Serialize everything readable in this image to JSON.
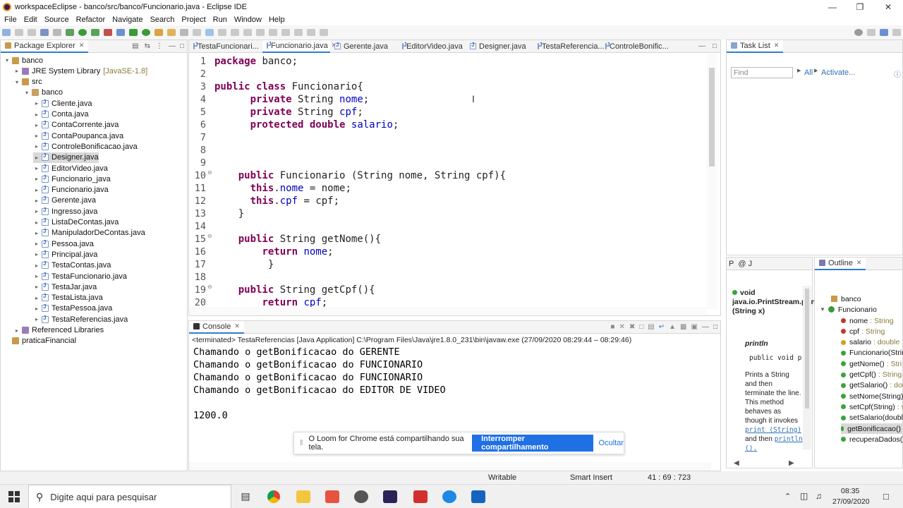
{
  "window": {
    "title": "workspaceEclipse - banco/src/banco/Funcionario.java - Eclipse IDE"
  },
  "menu": [
    "File",
    "Edit",
    "Source",
    "Refactor",
    "Navigate",
    "Search",
    "Project",
    "Run",
    "Window",
    "Help"
  ],
  "package_explorer": {
    "tab_label": "Package Explorer",
    "project": "banco",
    "jre": "JRE System Library",
    "jre_version": "[JavaSE-1.8]",
    "src": "src",
    "package": "banco",
    "files": [
      "Cliente.java",
      "Conta.java",
      "ContaCorrente.java",
      "ContaPoupanca.java",
      "ControleBonificacao.java",
      "Designer.java",
      "EditorVideo.java",
      "Funcionario_java",
      "Funcionario.java",
      "Gerente.java",
      "Ingresso.java",
      "ListaDeContas.java",
      "ManipuladorDeContas.java",
      "Pessoa.java",
      "Principal.java",
      "TestaContas.java",
      "TestaFuncionario.java",
      "TestaJar.java",
      "TestaLista.java",
      "TestaPessoa.java",
      "TestaReferencias.java"
    ],
    "selected_file": "Designer.java",
    "referenced_libraries": "Referenced Libraries",
    "other_project": "praticaFinancial"
  },
  "editor": {
    "tabs": [
      "TestaFuncionari...",
      "Funcionario.java",
      "Gerente.java",
      "EditorVideo.java",
      "Designer.java",
      "TestaReferencia...",
      "ControleBonific..."
    ],
    "active_tab": "Funcionario.java",
    "line_numbers": [
      "1",
      "2",
      "3",
      "4",
      "5",
      "6",
      "7",
      "8",
      "9",
      "10",
      "11",
      "12",
      "13",
      "14",
      "15",
      "16",
      "17",
      "18",
      "19",
      "20"
    ],
    "lines": [
      [
        [
          "kw",
          "package"
        ],
        [
          "t",
          " banco;"
        ]
      ],
      [],
      [
        [
          "kw",
          "public"
        ],
        [
          "t",
          " "
        ],
        [
          "kw",
          "class"
        ],
        [
          "t",
          " Funcionario{"
        ]
      ],
      [
        [
          "t",
          "      "
        ],
        [
          "kw",
          "private"
        ],
        [
          "t",
          " String "
        ],
        [
          "f",
          "nome"
        ],
        [
          "t",
          ";"
        ]
      ],
      [
        [
          "t",
          "      "
        ],
        [
          "kw",
          "private"
        ],
        [
          "t",
          " String "
        ],
        [
          "f",
          "cpf"
        ],
        [
          "t",
          ";"
        ]
      ],
      [
        [
          "t",
          "      "
        ],
        [
          "kw",
          "protected"
        ],
        [
          "t",
          " "
        ],
        [
          "kw",
          "double"
        ],
        [
          "t",
          " "
        ],
        [
          "f",
          "salario"
        ],
        [
          "t",
          ";"
        ]
      ],
      [],
      [],
      [],
      [
        [
          "t",
          "    "
        ],
        [
          "kw",
          "public"
        ],
        [
          "t",
          " Funcionario (String nome, String cpf){"
        ]
      ],
      [
        [
          "t",
          "      "
        ],
        [
          "kw",
          "this"
        ],
        [
          "t",
          "."
        ],
        [
          "f",
          "nome"
        ],
        [
          "t",
          " = nome;"
        ]
      ],
      [
        [
          "t",
          "      "
        ],
        [
          "kw",
          "this"
        ],
        [
          "t",
          "."
        ],
        [
          "f",
          "cpf"
        ],
        [
          "t",
          " = cpf;"
        ]
      ],
      [
        [
          "t",
          "    }"
        ]
      ],
      [],
      [
        [
          "t",
          "    "
        ],
        [
          "kw",
          "public"
        ],
        [
          "t",
          " String getNome(){"
        ]
      ],
      [
        [
          "t",
          "        "
        ],
        [
          "kw",
          "return"
        ],
        [
          "t",
          " "
        ],
        [
          "f",
          "nome"
        ],
        [
          "t",
          ";"
        ]
      ],
      [
        [
          "t",
          "         }"
        ]
      ],
      [],
      [
        [
          "t",
          "    "
        ],
        [
          "kw",
          "public"
        ],
        [
          "t",
          " String getCpf(){"
        ]
      ],
      [
        [
          "t",
          "        "
        ],
        [
          "kw",
          "return"
        ],
        [
          "t",
          " "
        ],
        [
          "f",
          "cpf"
        ],
        [
          "t",
          ";"
        ]
      ]
    ]
  },
  "tasklist": {
    "tab_label": "Task List",
    "find_placeholder": "Find",
    "all_label": "All",
    "activate_label": "Activate..."
  },
  "javadoc": {
    "signature": "void java.io.PrintStream.println (String x)",
    "name": "println",
    "code": "public void p",
    "desc_1": "Prints a String and then terminate the line. This method behaves as though it invokes",
    "link_1": "print (String)",
    "desc_2": "and then",
    "link_2": "println ()."
  },
  "outline": {
    "tab_label": "Outline",
    "package": "banco",
    "class": "Funcionario",
    "members": [
      {
        "name": "nome",
        "type": " : String"
      },
      {
        "name": "cpf",
        "type": " : String"
      },
      {
        "name": "salario",
        "type": " : double"
      },
      {
        "name": "Funcionario(Strin",
        "type": ""
      },
      {
        "name": "getNome()",
        "type": " : Stri"
      },
      {
        "name": "getCpf()",
        "type": " : String"
      },
      {
        "name": "getSalario()",
        "type": " : dou"
      },
      {
        "name": "setNome(String)",
        "type": ""
      },
      {
        "name": "setCpf(String)",
        "type": " : v"
      },
      {
        "name": "setSalario(doubl",
        "type": ""
      },
      {
        "name": "getBonificacao()",
        "type": ""
      },
      {
        "name": "recuperaDados()",
        "type": ""
      }
    ]
  },
  "console": {
    "tab_label": "Console",
    "header": "<terminated> TestaReferencias [Java Application] C:\\Program Files\\Java\\jre1.8.0_231\\bin\\javaw.exe  (27/09/2020 08:29:44 – 08:29:46)",
    "lines": [
      "Chamando o getBonificacao do GERENTE",
      "Chamando o getBonificacao do FUNCIONARIO",
      "Chamando o getBonificacao do FUNCIONARIO",
      "Chamando o getBonificacao do EDITOR DE VIDEO",
      "",
      "1200.0"
    ]
  },
  "loom": {
    "message": "O Loom for Chrome está compartilhando sua tela.",
    "stop_button": "Interromper compartilhamento",
    "hide_button": "Ocultar"
  },
  "statusbar": {
    "writable": "Writable",
    "insert_mode": "Smart Insert",
    "position": "41 : 69 : 723"
  },
  "taskbar": {
    "search_placeholder": "Digite aqui para pesquisar",
    "time": "08:35",
    "date": "27/09/2020"
  },
  "colors": {
    "accent": "#2f7dd1",
    "keyword": "#7f0055",
    "field": "#0000c0",
    "loom_button": "#1f6fe5"
  }
}
